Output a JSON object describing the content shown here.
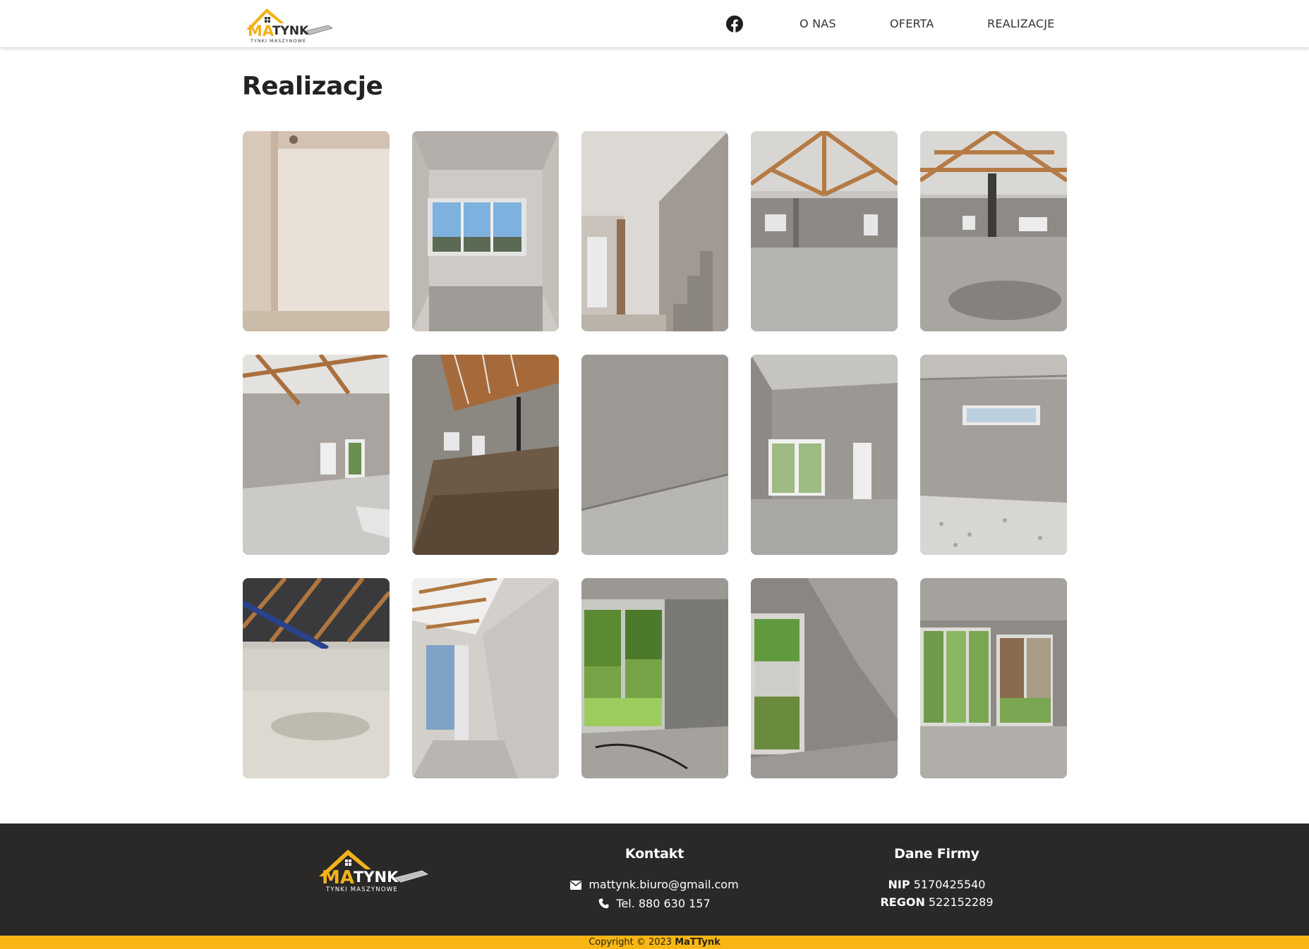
{
  "brand": {
    "logo_text_a": "MA",
    "logo_text_b": "TYNK",
    "logo_tagline": "TYNKI MASZYNOWE",
    "colors": {
      "gold": "#f2b21a",
      "dark": "#2a2928",
      "bar": "#f7b614"
    }
  },
  "nav": {
    "facebook_icon": "facebook-icon",
    "items": [
      {
        "label": "O NAS"
      },
      {
        "label": "OFERTA"
      },
      {
        "label": "REALIZACJE"
      }
    ]
  },
  "page": {
    "title": "Realizacje"
  },
  "gallery": {
    "photos": [
      {
        "scene": "plastered wall corner with pipe"
      },
      {
        "scene": "room with large window"
      },
      {
        "scene": "hallway with concrete stairs"
      },
      {
        "scene": "open space with timber roof trusses"
      },
      {
        "scene": "open space with steel column and trusses"
      },
      {
        "scene": "attic room with windows"
      },
      {
        "scene": "attic room with sand floor"
      },
      {
        "scene": "grey plastered wall close-up"
      },
      {
        "scene": "room with windows and doors"
      },
      {
        "scene": "room with gravel floor and high window"
      },
      {
        "scene": "hall with black roof and gravel floor"
      },
      {
        "scene": "attic corridor"
      },
      {
        "scene": "room with patio door and garden"
      },
      {
        "scene": "room with sloped ceiling and balcony door"
      },
      {
        "scene": "corner room with windows to garden"
      }
    ]
  },
  "footer": {
    "contact": {
      "heading": "Kontakt",
      "email": "mattynk.biuro@gmail.com",
      "phone": "Tel. 880 630 157",
      "email_icon": "envelope-icon",
      "phone_icon": "phone-icon"
    },
    "company": {
      "heading": "Dane Firmy",
      "nip_label": "NIP",
      "nip": "5170425540",
      "regon_label": "REGON",
      "regon": "522152289"
    },
    "copyright_prefix": "Copyright © 2023",
    "copyright_brand": "MaTTynk"
  }
}
